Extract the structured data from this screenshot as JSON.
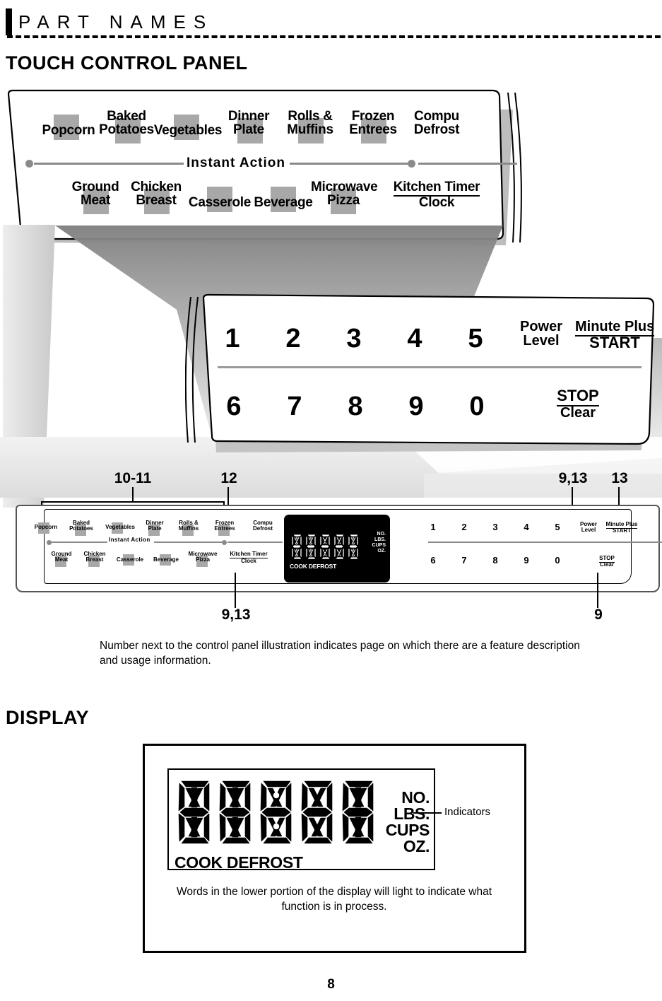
{
  "running_head": {
    "title": "PART NAMES"
  },
  "sections": {
    "touch_control_panel": "TOUCH CONTROL PANEL",
    "display": "DISPLAY"
  },
  "panel": {
    "instant_action_label": "Instant Action",
    "top_row": [
      {
        "line1": "Popcorn",
        "line2": "",
        "pad": true
      },
      {
        "line1": "Baked",
        "line2": "Potatoes",
        "pad": true
      },
      {
        "line1": "Vegetables",
        "line2": "",
        "pad": true
      },
      {
        "line1": "Dinner",
        "line2": "Plate",
        "pad": true
      },
      {
        "line1": "Rolls &",
        "line2": "Muffins",
        "pad": true
      },
      {
        "line1": "Frozen",
        "line2": "Entrees",
        "pad": true
      },
      {
        "line1": "Compu",
        "line2": "Defrost",
        "pad": false
      }
    ],
    "bottom_row": [
      {
        "line1": "Ground",
        "line2": "Meat",
        "pad": true
      },
      {
        "line1": "Chicken",
        "line2": "Breast",
        "pad": true
      },
      {
        "line1": "Casserole",
        "line2": "",
        "pad": true
      },
      {
        "line1": "Beverage",
        "line2": "",
        "pad": true
      },
      {
        "line1": "Microwave",
        "line2": "Pizza",
        "pad": true
      },
      {
        "line1": "Kitchen Timer",
        "line2": "Clock",
        "pad": false,
        "split": true
      }
    ]
  },
  "keypad": {
    "row1_digits": [
      "1",
      "2",
      "3",
      "4",
      "5"
    ],
    "row2_digits": [
      "6",
      "7",
      "8",
      "9",
      "0"
    ],
    "power_level": {
      "line1": "Power",
      "line2": "Level"
    },
    "minute_plus_start": {
      "line1": "Minute Plus",
      "line2": "START"
    },
    "stop_clear": {
      "line1": "STOP",
      "line2": "Clear"
    }
  },
  "callouts": {
    "bracket_10_11": "10-11",
    "compu_defrost": "12",
    "power_level": "9,13",
    "minute_plus": "13",
    "kitchen_timer": "9,13",
    "stop_clear": "9"
  },
  "display_figure": {
    "indicators": [
      "NO.",
      "LBS.",
      "CUPS",
      "OZ."
    ],
    "lower_words": "COOK DEFROST",
    "indicator_callout": "Indicators",
    "caption": "Words in the lower portion of the display will light to indicate what function is in process."
  },
  "notes": {
    "panel_note": "Number next to the control panel illustration indicates page on which there are a feature description and usage information."
  },
  "page_number": "8",
  "colors": {
    "pad_grey": "#a8a8a8",
    "line_grey": "#8a8a8a",
    "ink": "#000000"
  }
}
